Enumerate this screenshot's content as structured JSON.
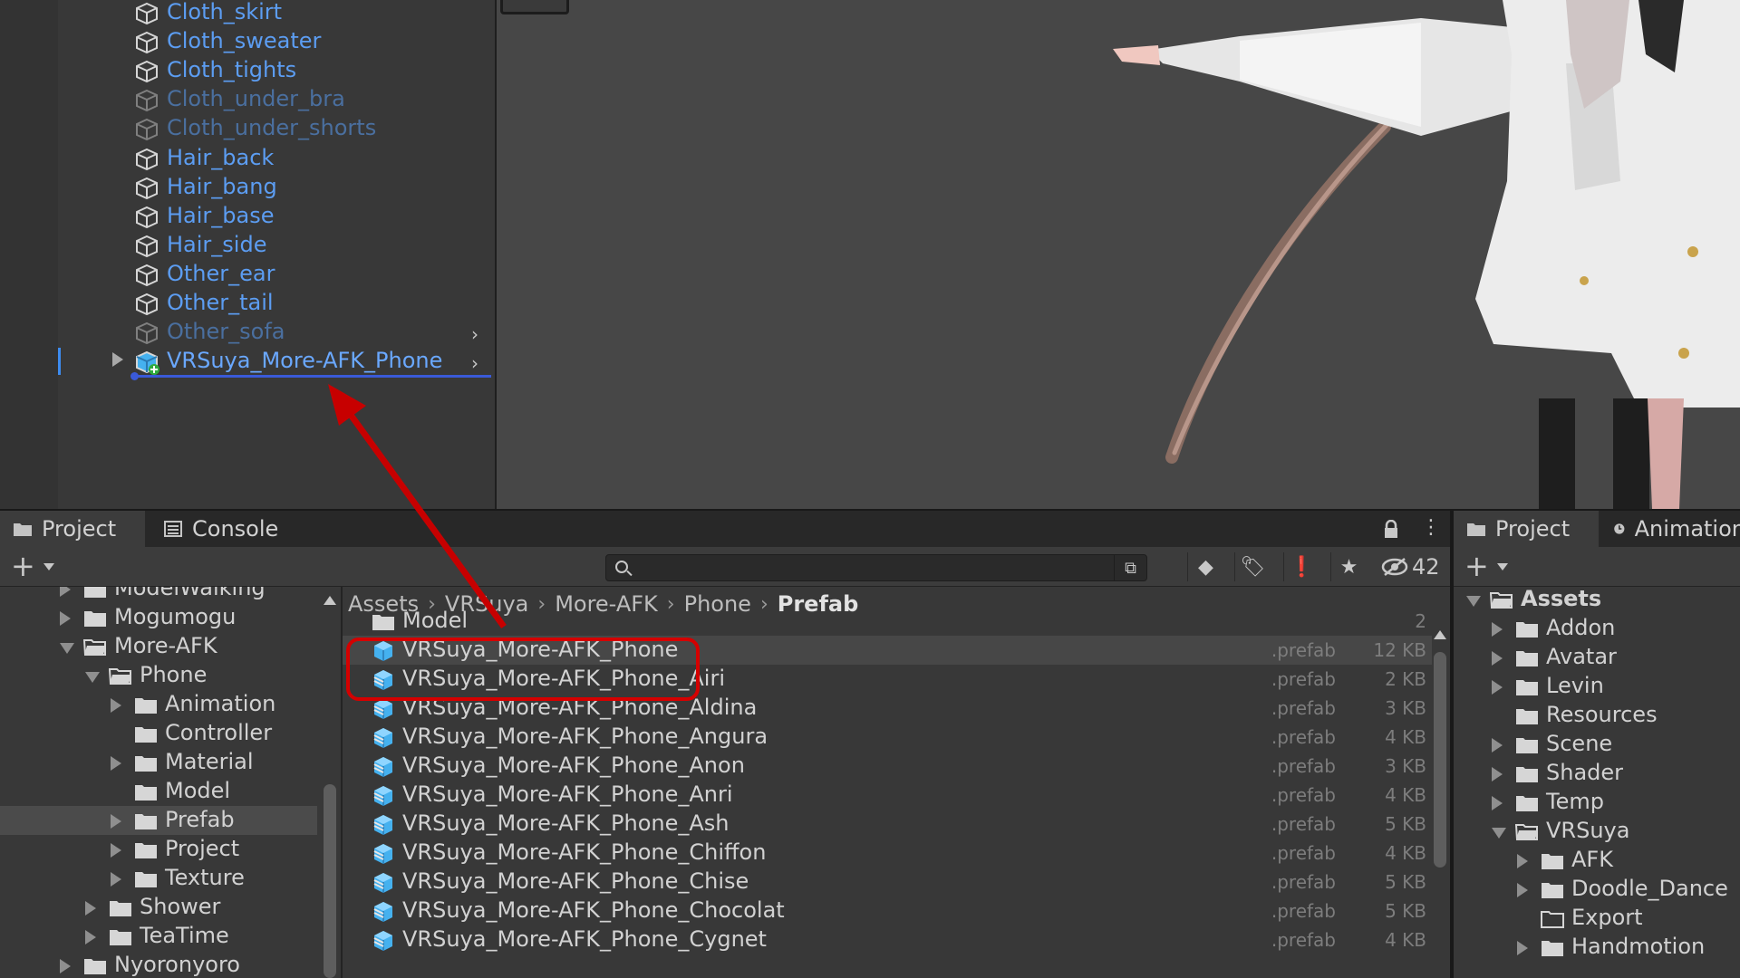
{
  "hierarchy": {
    "items": [
      {
        "label": "Cloth_skirt",
        "dim": false
      },
      {
        "label": "Cloth_sweater",
        "dim": false
      },
      {
        "label": "Cloth_tights",
        "dim": false
      },
      {
        "label": "Cloth_under_bra",
        "dim": true
      },
      {
        "label": "Cloth_under_shorts",
        "dim": true
      },
      {
        "label": "Hair_back",
        "dim": false
      },
      {
        "label": "Hair_bang",
        "dim": false
      },
      {
        "label": "Hair_base",
        "dim": false
      },
      {
        "label": "Hair_side",
        "dim": false
      },
      {
        "label": "Other_ear",
        "dim": false
      },
      {
        "label": "Other_tail",
        "dim": false
      },
      {
        "label": "Other_sofa",
        "dim": true
      },
      {
        "label": "VRSuya_More-AFK_Phone",
        "dim": false
      }
    ],
    "chevron": "›"
  },
  "bottom_left": {
    "tabs": [
      {
        "label": "Project",
        "icon": "folder-icon"
      },
      {
        "label": "Console",
        "icon": "console-icon"
      }
    ],
    "toolbar": {
      "add": "+",
      "search_placeholder": "",
      "hidden_count": "42"
    },
    "tree": [
      {
        "label": "ModelWalking",
        "depth": 1,
        "arrow": "right"
      },
      {
        "label": "Mogumogu",
        "depth": 1,
        "arrow": "right"
      },
      {
        "label": "More-AFK",
        "depth": 1,
        "arrow": "down",
        "open": true
      },
      {
        "label": "Phone",
        "depth": 2,
        "arrow": "down",
        "open": true
      },
      {
        "label": "Animation",
        "depth": 3,
        "arrow": "right"
      },
      {
        "label": "Controller",
        "depth": 3,
        "arrow": "none"
      },
      {
        "label": "Material",
        "depth": 3,
        "arrow": "right"
      },
      {
        "label": "Model",
        "depth": 3,
        "arrow": "none"
      },
      {
        "label": "Prefab",
        "depth": 3,
        "arrow": "right",
        "selected": true
      },
      {
        "label": "Project",
        "depth": 3,
        "arrow": "right"
      },
      {
        "label": "Texture",
        "depth": 3,
        "arrow": "right"
      },
      {
        "label": "Shower",
        "depth": 2,
        "arrow": "right"
      },
      {
        "label": "TeaTime",
        "depth": 2,
        "arrow": "right"
      },
      {
        "label": "Nyoronyoro",
        "depth": 1,
        "arrow": "right"
      }
    ],
    "breadcrumb": [
      "Assets",
      "VRSuya",
      "More-AFK",
      "Phone",
      "Prefab"
    ],
    "files": [
      {
        "name": "Model",
        "type": "folder",
        "ext": "",
        "size": "",
        "count": "2"
      },
      {
        "name": "VRSuya_More-AFK_Phone",
        "type": "prefab",
        "ext": ".prefab",
        "size": "12 KB",
        "selected": true
      },
      {
        "name": "VRSuya_More-AFK_Phone_Airi",
        "type": "variant",
        "ext": ".prefab",
        "size": "2 KB"
      },
      {
        "name": "VRSuya_More-AFK_Phone_Aldina",
        "type": "variant",
        "ext": ".prefab",
        "size": "3 KB"
      },
      {
        "name": "VRSuya_More-AFK_Phone_Angura",
        "type": "variant",
        "ext": ".prefab",
        "size": "4 KB"
      },
      {
        "name": "VRSuya_More-AFK_Phone_Anon",
        "type": "variant",
        "ext": ".prefab",
        "size": "3 KB"
      },
      {
        "name": "VRSuya_More-AFK_Phone_Anri",
        "type": "variant",
        "ext": ".prefab",
        "size": "4 KB"
      },
      {
        "name": "VRSuya_More-AFK_Phone_Ash",
        "type": "variant",
        "ext": ".prefab",
        "size": "5 KB"
      },
      {
        "name": "VRSuya_More-AFK_Phone_Chiffon",
        "type": "variant",
        "ext": ".prefab",
        "size": "4 KB"
      },
      {
        "name": "VRSuya_More-AFK_Phone_Chise",
        "type": "variant",
        "ext": ".prefab",
        "size": "5 KB"
      },
      {
        "name": "VRSuya_More-AFK_Phone_Chocolat",
        "type": "variant",
        "ext": ".prefab",
        "size": "5 KB"
      },
      {
        "name": "VRSuya_More-AFK_Phone_Cygnet",
        "type": "variant",
        "ext": ".prefab",
        "size": "4 KB"
      }
    ]
  },
  "bottom_right": {
    "tabs": [
      {
        "label": "Project",
        "icon": "folder-icon"
      },
      {
        "label": "Animation",
        "icon": "clock-icon"
      }
    ],
    "add": "+",
    "tree": [
      {
        "label": "Assets",
        "depth": 0,
        "arrow": "down",
        "open": true,
        "bold": true
      },
      {
        "label": "Addon",
        "depth": 1,
        "arrow": "right"
      },
      {
        "label": "Avatar",
        "depth": 1,
        "arrow": "right"
      },
      {
        "label": "Levin",
        "depth": 1,
        "arrow": "right"
      },
      {
        "label": "Resources",
        "depth": 1,
        "arrow": "none"
      },
      {
        "label": "Scene",
        "depth": 1,
        "arrow": "right"
      },
      {
        "label": "Shader",
        "depth": 1,
        "arrow": "right"
      },
      {
        "label": "Temp",
        "depth": 1,
        "arrow": "right"
      },
      {
        "label": "VRSuya",
        "depth": 1,
        "arrow": "down",
        "open": true
      },
      {
        "label": "AFK",
        "depth": 2,
        "arrow": "right"
      },
      {
        "label": "Doodle_Dance",
        "depth": 2,
        "arrow": "right"
      },
      {
        "label": "Export",
        "depth": 2,
        "arrow": "none",
        "empty": true
      },
      {
        "label": "Handmotion",
        "depth": 2,
        "arrow": "right"
      }
    ]
  },
  "colors": {
    "accent": "#3d8cf0",
    "hierarchy_text": "#5c9df2",
    "annotation": "#d50000"
  }
}
